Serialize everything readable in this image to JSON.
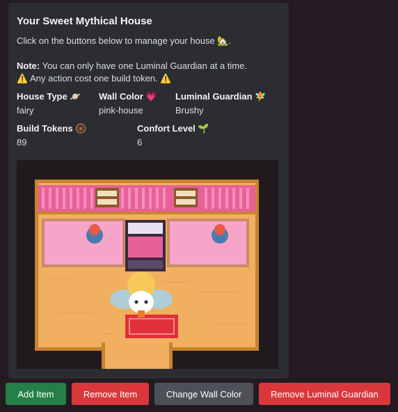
{
  "embed": {
    "title": "Your Sweet Mythical House",
    "line1": "Click on the buttons below to manage your house",
    "line1_emoji": "🏡",
    "line1_end": ".",
    "note_label": "Note:",
    "note_text": " You can only have one Luminal Guardian at a time.",
    "warn_emoji": "⚠️",
    "warn_text": " Any action cost one build token. ",
    "fields": {
      "house_type": {
        "name": "House Type",
        "emoji": "🪐",
        "value": "fairy"
      },
      "wall_color": {
        "name": "Wall Color",
        "emoji": "💗",
        "value": "pink-house"
      },
      "luminal_guardian": {
        "name": "Luminal Guardian",
        "emoji": "🧚",
        "value": "Brushy"
      },
      "build_tokens": {
        "name": "Build Tokens",
        "emoji": "🛞",
        "value": "89"
      },
      "confort_level": {
        "name": "Confort Level",
        "emoji": "🌱",
        "value": "6"
      }
    }
  },
  "buttons": {
    "add_item": "Add Item",
    "remove_item": "Remove Item",
    "change_wall_color": "Change Wall Color",
    "remove_luminal_guardian": "Remove Luminal Guardian"
  },
  "colors": {
    "green": "#248046",
    "red": "#da373c",
    "grey": "#4e5058",
    "wall_pink": "#e8609a",
    "floor": "#f0b060"
  }
}
